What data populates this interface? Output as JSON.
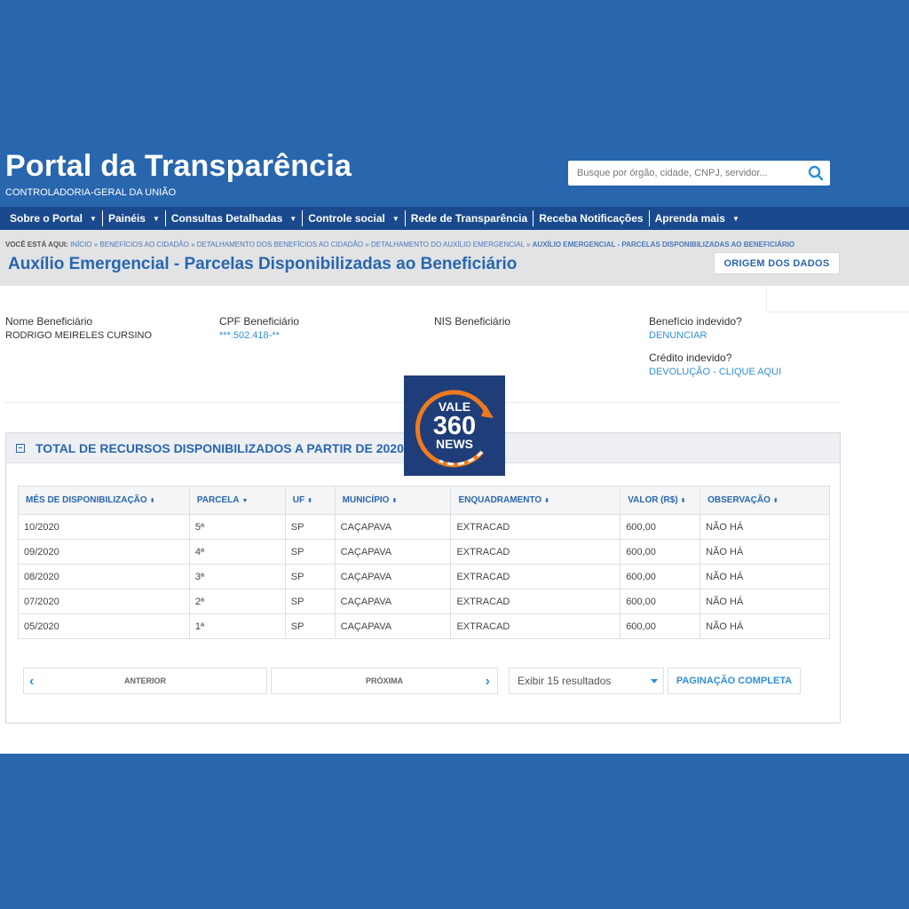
{
  "header": {
    "title": "Portal da Transparência",
    "subtitle": "CONTROLADORIA-GERAL DA UNIÃO",
    "search_placeholder": "Busque por órgão, cidade, CNPJ, servidor..."
  },
  "nav": [
    {
      "label": "Sobre o Portal",
      "caret": "▼"
    },
    {
      "label": "Painéis",
      "caret": "▼"
    },
    {
      "label": "Consultas Detalhadas",
      "caret": "▼"
    },
    {
      "label": "Controle social",
      "caret": "▼"
    },
    {
      "label": "Rede de Transparência",
      "caret": ""
    },
    {
      "label": "Receba Notificações",
      "caret": ""
    },
    {
      "label": "Aprenda mais",
      "caret": "▼"
    }
  ],
  "breadcrumb": {
    "lead": "VOCÊ ESTÁ AQUI:",
    "path": "INÍCIO » BENEFÍCIOS AO CIDADÃO » DETALHAMENTO DOS BENEFÍCIOS AO CIDADÃO » DETALHAMENTO DO AUXÍLIO EMERGENCIAL »",
    "current": "AUXÍLIO EMERGENCIAL - PARCELAS DISPONIBILIZADAS AO BENEFICIÁRIO"
  },
  "page_title": "Auxílio Emergencial - Parcelas Disponibilizadas ao Beneficiário",
  "origin_button": "ORIGEM DOS DADOS",
  "beneficiary": {
    "name_label": "Nome Beneficiário",
    "name": "RODRIGO MEIRELES CURSINO",
    "cpf_label": "CPF Beneficiário",
    "cpf": "***.502.418-**",
    "nis_label": "NIS Beneficiário",
    "undue_benefit_label": "Benefício indevido?",
    "undue_benefit_link": "DENUNCIAR",
    "undue_credit_label": "Crédito indevido?",
    "undue_credit_link": "DEVOLUÇÃO - CLIQUE AQUI"
  },
  "logo": {
    "line1": "VALE",
    "line2": "360",
    "line3": "NEWS"
  },
  "panel": {
    "title": "TOTAL DE RECURSOS DISPONIBILIZADOS A PARTIR DE 2020",
    "columns": [
      {
        "label": "MÊS DE DISPONIBILIZAÇÃO",
        "sort": "⬍"
      },
      {
        "label": "PARCELA",
        "sort": "▼"
      },
      {
        "label": "UF",
        "sort": "⬍"
      },
      {
        "label": "MUNICÍPIO",
        "sort": "⬍"
      },
      {
        "label": "ENQUADRAMENTO",
        "sort": "⬍"
      },
      {
        "label": "VALOR (R$)",
        "sort": "⬍"
      },
      {
        "label": "OBSERVAÇÃO",
        "sort": "⬍"
      }
    ],
    "rows": [
      [
        "10/2020",
        "5ª",
        "SP",
        "CAÇAPAVA",
        "EXTRACAD",
        "600,00",
        "NÃO HÁ"
      ],
      [
        "09/2020",
        "4ª",
        "SP",
        "CAÇAPAVA",
        "EXTRACAD",
        "600,00",
        "NÃO HÁ"
      ],
      [
        "08/2020",
        "3ª",
        "SP",
        "CAÇAPAVA",
        "EXTRACAD",
        "600,00",
        "NÃO HÁ"
      ],
      [
        "07/2020",
        "2ª",
        "SP",
        "CAÇAPAVA",
        "EXTRACAD",
        "600,00",
        "NÃO HÁ"
      ],
      [
        "05/2020",
        "1ª",
        "SP",
        "CAÇAPAVA",
        "EXTRACAD",
        "600,00",
        "NÃO HÁ"
      ]
    ]
  },
  "pagination": {
    "previous": "ANTERIOR",
    "next": "PRÓXIMA",
    "page_size": "Exibir 15 resultados",
    "full": "PAGINAÇÃO COMPLETA"
  },
  "colors": {
    "brand_blue": "#2866ae",
    "nav_blue": "#1a4a8d",
    "link_blue": "#2f8fd6",
    "logo_orange": "#f07a1e"
  }
}
